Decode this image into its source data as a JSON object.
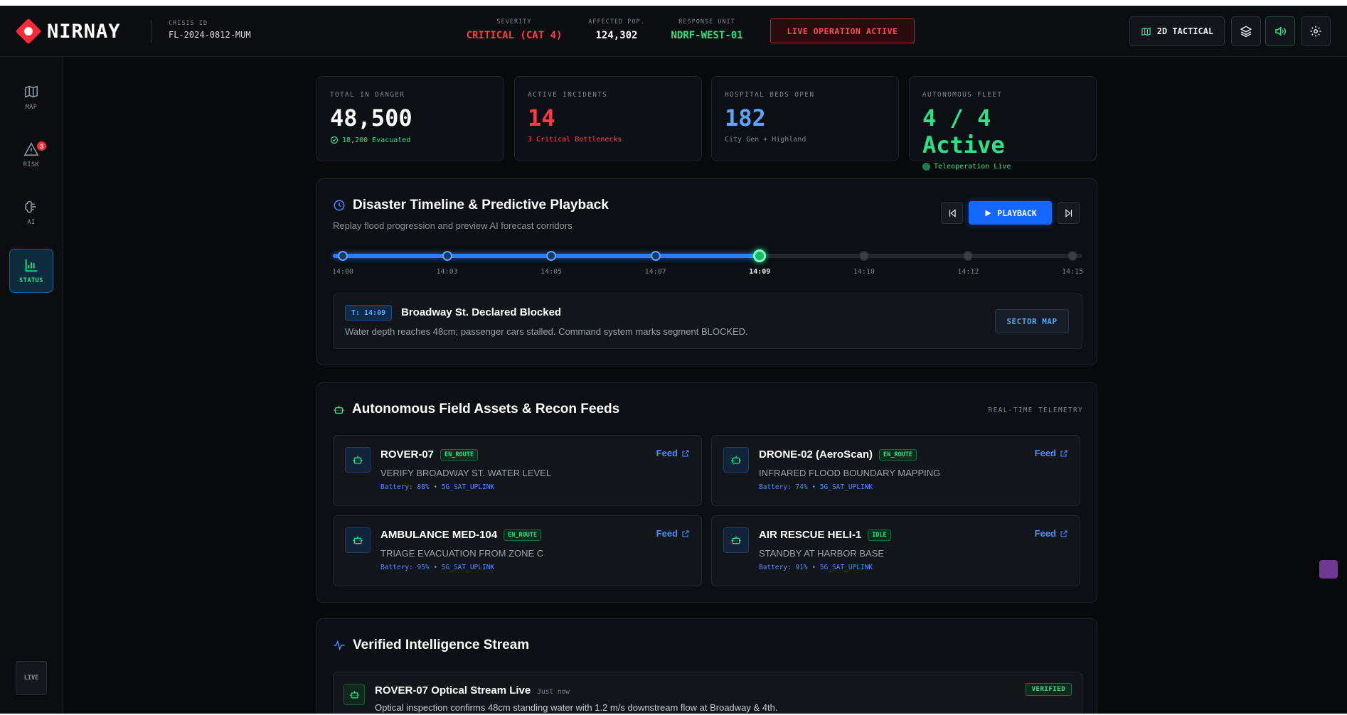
{
  "header": {
    "app_name": "NIRNAY",
    "crisis_label": "CRISIS ID",
    "crisis_id": "FL-2024-0812-MUM",
    "severity_label": "SEVERITY",
    "severity_value": "CRITICAL (CAT 4)",
    "population_label": "AFFECTED POP.",
    "population_value": "124,302",
    "unit_label": "RESPONSE UNIT",
    "unit_value": "NDRF-WEST-01",
    "live_op": "LIVE OPERATION ACTIVE",
    "view_button": "2D TACTICAL",
    "icons": [
      "map-icon",
      "layers-icon",
      "speaker-icon",
      "settings-icon"
    ]
  },
  "sidebar": {
    "items": [
      {
        "label": "MAP",
        "icon": "map-icon"
      },
      {
        "label": "RISK",
        "icon": "alert-icon",
        "badge": "3"
      },
      {
        "label": "AI",
        "icon": "brain-icon"
      },
      {
        "label": "STATUS",
        "icon": "bar-chart-icon",
        "active": true
      }
    ],
    "live_label": "LIVE"
  },
  "kpis": [
    {
      "label": "TOTAL IN DANGER",
      "value": "48,500",
      "sub": "18,200 Evacuated",
      "color": "#ffffff"
    },
    {
      "label": "ACTIVE INCIDENTS",
      "value": "14",
      "sub": "3 Critical Bottlenecks",
      "color": "#ff3a48"
    },
    {
      "label": "HOSPITAL BEDS OPEN",
      "value": "182",
      "sub": "City Gen + Highland",
      "color": "#5aa5ff"
    },
    {
      "label": "AUTONOMOUS FLEET",
      "value": "4 / 4 Active",
      "sub": "Teleoperation Live",
      "color": "#2ee08a"
    }
  ],
  "timeline": {
    "title": "Disaster Timeline & Predictive Playback",
    "subtitle": "Replay flood progression and preview AI forecast corridors",
    "play_label": "PLAYBACK",
    "ticks": [
      "14:00",
      "14:03",
      "14:05",
      "14:07",
      "14:09",
      "14:10",
      "14:12",
      "14:15"
    ],
    "current_index": 4,
    "progress": 0.571,
    "event": {
      "time": "T: 14:09",
      "title": "Broadway St. Declared Blocked",
      "description": "Water depth reaches 48cm; passenger cars stalled. Command system marks segment BLOCKED.",
      "button": "SECTOR MAP"
    }
  },
  "assets": {
    "title": "Autonomous Field Assets & Recon Feeds",
    "tag": "REAL-TIME TELEMETRY",
    "feed_label": "Feed",
    "items": [
      {
        "name": "ROVER-07",
        "status": "EN_ROUTE",
        "task": "VERIFY BROADWAY ST. WATER LEVEL",
        "telemetry": "Battery: 88% • 5G_SAT_UPLINK"
      },
      {
        "name": "DRONE-02 (AeroScan)",
        "status": "EN_ROUTE",
        "task": "INFRARED FLOOD BOUNDARY MAPPING",
        "telemetry": "Battery: 74% • 5G_SAT_UPLINK"
      },
      {
        "name": "AMBULANCE MED-104",
        "status": "EN_ROUTE",
        "task": "TRIAGE EVACUATION FROM ZONE C",
        "telemetry": "Battery: 95% • 5G_SAT_UPLINK"
      },
      {
        "name": "AIR RESCUE HELI-1",
        "status": "IDLE",
        "task": "STANDBY AT HARBOR BASE",
        "telemetry": "Battery: 91% • 5G_SAT_UPLINK"
      }
    ]
  },
  "intel": {
    "title": "Verified Intelligence Stream",
    "items": [
      {
        "title": "ROVER-07 Optical Stream Live",
        "time": "Just now",
        "description": "Optical inspection confirms 48cm standing water with 1.2 m/s downstream flow at Broadway & 4th.",
        "badge": "VERIFIED"
      }
    ]
  }
}
